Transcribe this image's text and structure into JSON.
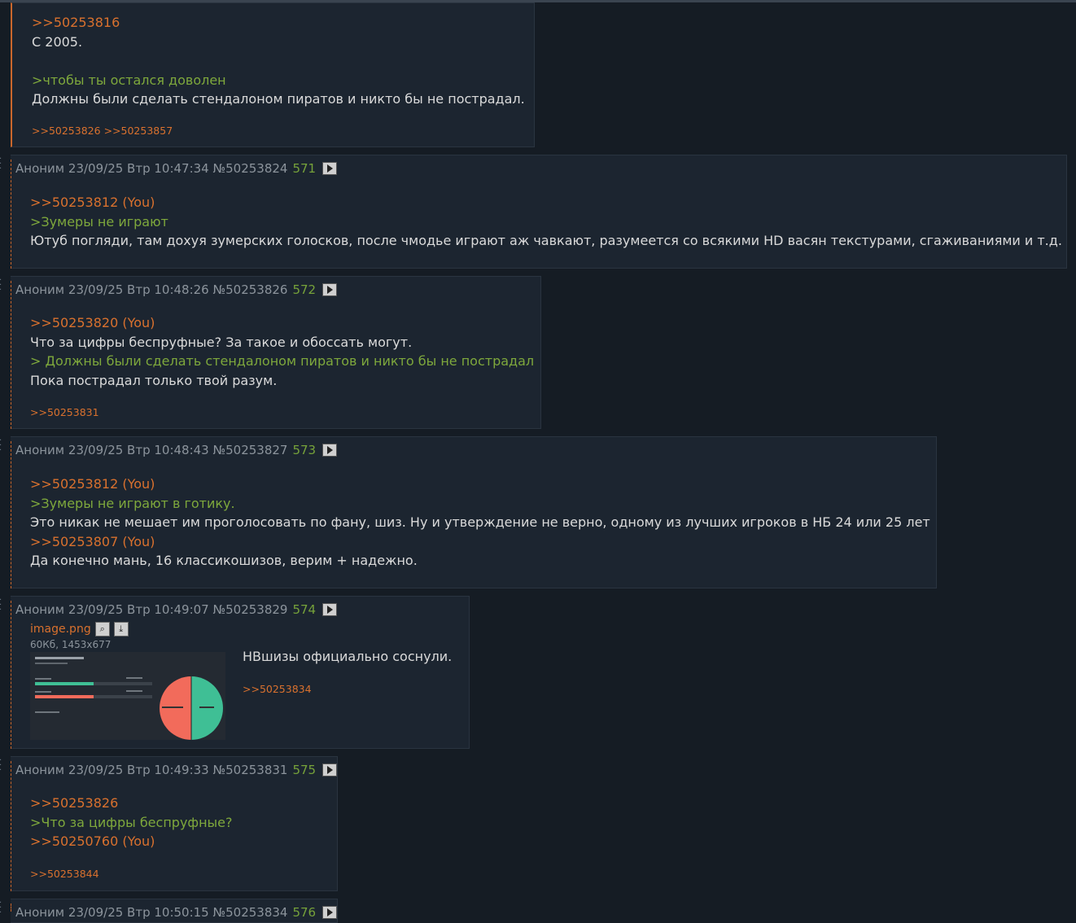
{
  "posts": [
    {
      "lines": [
        {
          "cls": "ref",
          "text": ">>50253816"
        },
        {
          "cls": "txt",
          "text": "С 2005."
        },
        {
          "cls": "txt",
          "text": ""
        },
        {
          "cls": "quote",
          "text": ">чтобы ты остался доволен"
        },
        {
          "cls": "txt",
          "text": "Должны были сделать стендалоном пиратов и никто бы не пострадал."
        }
      ],
      "replies": [
        ">>50253826",
        ">>50253857"
      ]
    },
    {
      "header": {
        "author": "Аноним",
        "date": "23/09/25 Втр 10:47:34",
        "id": "№50253824",
        "num": "571"
      },
      "lines": [
        {
          "cls": "ref",
          "text": ">>50253812 (You)"
        },
        {
          "cls": "quote",
          "text": ">Зумеры не играют"
        },
        {
          "cls": "txt",
          "text": "Ютуб погляди, там дохуя зумерских голосков, после чмодье играют аж чавкают, разумеется со всякими HD васян текстурами, сгаживаниями и т.д."
        }
      ],
      "replies": []
    },
    {
      "header": {
        "author": "Аноним",
        "date": "23/09/25 Втр 10:48:26",
        "id": "№50253826",
        "num": "572"
      },
      "lines": [
        {
          "cls": "ref",
          "text": ">>50253820 (You)"
        },
        {
          "cls": "txt",
          "text": "Что за цифры беспруфные? За такое и обоссать могут."
        },
        {
          "cls": "quote",
          "text": "> Должны были сделать стендалоном пиратов и никто бы не пострадал"
        },
        {
          "cls": "txt",
          "text": "Пока пострадал только твой разум."
        }
      ],
      "replies": [
        ">>50253831"
      ]
    },
    {
      "header": {
        "author": "Аноним",
        "date": "23/09/25 Втр 10:48:43",
        "id": "№50253827",
        "num": "573"
      },
      "lines": [
        {
          "cls": "ref",
          "text": ">>50253812 (You)"
        },
        {
          "cls": "quote",
          "text": ">Зумеры не играют в готику."
        },
        {
          "cls": "txt",
          "text": "Это никак не мешает им проголосовать по фану, шиз. Ну и утверждение не верно, одному из лучших игроков в НБ 24 или 25 лет"
        },
        {
          "cls": "ref",
          "text": ">>50253807 (You)"
        },
        {
          "cls": "txt",
          "text": "Да конечно мань, 16 классикошизов, верим + надежно."
        }
      ],
      "replies": []
    },
    {
      "header": {
        "author": "Аноним",
        "date": "23/09/25 Втр 10:49:07",
        "id": "№50253829",
        "num": "574"
      },
      "file": {
        "name": "image.png",
        "meta": "60Кб, 1453x677"
      },
      "lines": [
        {
          "cls": "txt",
          "text": "НВшизы официально соснули."
        }
      ],
      "replies": [
        ">>50253834"
      ]
    },
    {
      "header": {
        "author": "Аноним",
        "date": "23/09/25 Втр 10:49:33",
        "id": "№50253831",
        "num": "575"
      },
      "lines": [
        {
          "cls": "ref",
          "text": ">>50253826"
        },
        {
          "cls": "quote",
          "text": ">Что за цифры беспруфные?"
        },
        {
          "cls": "ref",
          "text": ">>50250760 (You)"
        }
      ],
      "replies": [
        ">>50253844"
      ]
    },
    {
      "header": {
        "author": "Аноним",
        "date": "23/09/25 Втр 10:50:15",
        "id": "№50253834",
        "num": "576"
      },
      "lines": [],
      "replies": []
    }
  ]
}
